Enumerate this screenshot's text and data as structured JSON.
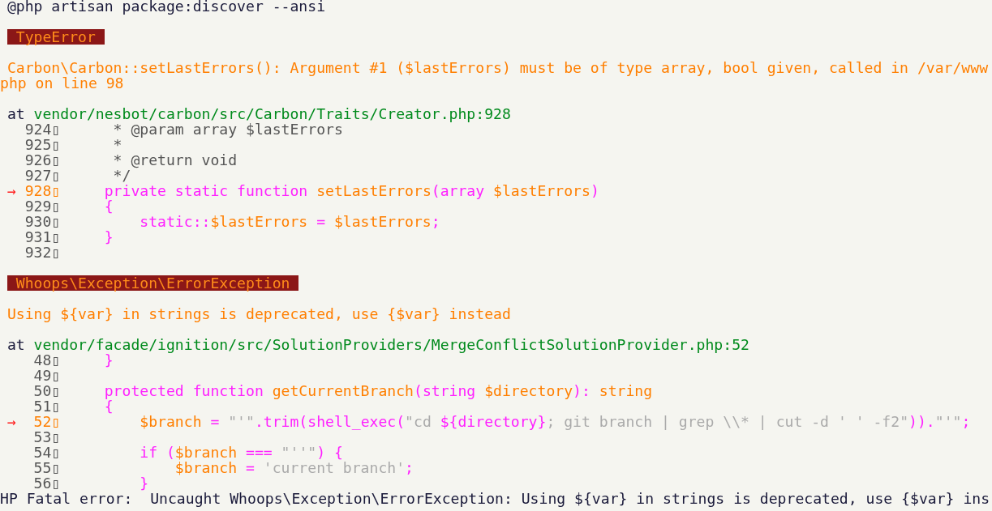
{
  "command": "@php artisan package:discover --ansi",
  "errors": [
    {
      "type": "TypeError",
      "message_lines": [
        "Carbon\\Carbon::setLastErrors(): Argument #1 ($lastErrors) must be of type array, bool given, called in /var/www",
        "php on line 98"
      ],
      "location": {
        "prefix": "at",
        "path": "vendor/nesbot/carbon/src/Carbon/Traits/Creator.php:928"
      },
      "code": [
        {
          "number": "924▯",
          "current": false,
          "segments": [
            {
              "kind": "comment",
              "text": "      * @param array $lastErrors"
            }
          ]
        },
        {
          "number": "925▯",
          "current": false,
          "segments": [
            {
              "kind": "comment",
              "text": "      *"
            }
          ]
        },
        {
          "number": "926▯",
          "current": false,
          "segments": [
            {
              "kind": "comment",
              "text": "      * @return void"
            }
          ]
        },
        {
          "number": "927▯",
          "current": false,
          "segments": [
            {
              "kind": "comment",
              "text": "      */"
            }
          ]
        },
        {
          "number": "928▯",
          "current": true,
          "marker": "→",
          "segments": [
            {
              "kind": "keyword",
              "text": "     private static function "
            },
            {
              "kind": "name",
              "text": "setLastErrors"
            },
            {
              "kind": "keyword",
              "text": "(array "
            },
            {
              "kind": "name",
              "text": "$lastErrors"
            },
            {
              "kind": "keyword",
              "text": ")"
            }
          ]
        },
        {
          "number": "929▯",
          "current": false,
          "segments": [
            {
              "kind": "keyword",
              "text": "     {"
            }
          ]
        },
        {
          "number": "930▯",
          "current": false,
          "segments": [
            {
              "kind": "keyword",
              "text": "         static::"
            },
            {
              "kind": "name",
              "text": "$lastErrors"
            },
            {
              "kind": "keyword",
              "text": " = "
            },
            {
              "kind": "name",
              "text": "$lastErrors"
            },
            {
              "kind": "keyword",
              "text": ";"
            }
          ]
        },
        {
          "number": "931▯",
          "current": false,
          "segments": [
            {
              "kind": "keyword",
              "text": "     }"
            }
          ]
        },
        {
          "number": "932▯",
          "current": false
        }
      ]
    },
    {
      "type": "Whoops\\Exception\\ErrorException",
      "message_lines": [
        "Using ${var} in strings is deprecated, use {$var} instead"
      ],
      "location": {
        "prefix": "at",
        "path": "vendor/facade/ignition/src/SolutionProviders/MergeConflictSolutionProvider.php:52"
      },
      "code": [
        {
          "number": "48▯",
          "current": false,
          "segments": [
            {
              "kind": "keyword",
              "text": "     }"
            }
          ]
        },
        {
          "number": "49▯",
          "current": false
        },
        {
          "number": "50▯",
          "current": false,
          "segments": [
            {
              "kind": "keyword",
              "text": "     protected function "
            },
            {
              "kind": "name",
              "text": "getCurrentBranch"
            },
            {
              "kind": "keyword",
              "text": "(string "
            },
            {
              "kind": "name",
              "text": "$directory"
            },
            {
              "kind": "keyword",
              "text": "): "
            },
            {
              "kind": "name",
              "text": "string"
            }
          ]
        },
        {
          "number": "51▯",
          "current": false,
          "segments": [
            {
              "kind": "keyword",
              "text": "     {"
            }
          ]
        },
        {
          "number": "52▯",
          "current": true,
          "marker": "→",
          "segments": [
            {
              "kind": "name",
              "text": "         $branch"
            },
            {
              "kind": "keyword",
              "text": " = "
            },
            {
              "kind": "string",
              "text": "\"'\""
            },
            {
              "kind": "keyword",
              "text": ".trim(shell_exec("
            },
            {
              "kind": "string",
              "text": "\"cd "
            },
            {
              "kind": "keyword",
              "text": "${directory}"
            },
            {
              "kind": "string",
              "text": "; git branch | grep \\\\* | cut -d ' ' -f2\""
            },
            {
              "kind": "keyword",
              "text": "))."
            },
            {
              "kind": "string",
              "text": "\"'\""
            },
            {
              "kind": "keyword",
              "text": ";"
            }
          ]
        },
        {
          "number": "53▯",
          "current": false
        },
        {
          "number": "54▯",
          "current": false,
          "segments": [
            {
              "kind": "keyword",
              "text": "         if ("
            },
            {
              "kind": "name",
              "text": "$branch"
            },
            {
              "kind": "keyword",
              "text": " === "
            },
            {
              "kind": "string",
              "text": "\"''\""
            },
            {
              "kind": "keyword",
              "text": ") {"
            }
          ]
        },
        {
          "number": "55▯",
          "current": false,
          "segments": [
            {
              "kind": "name",
              "text": "             $branch"
            },
            {
              "kind": "keyword",
              "text": " = "
            },
            {
              "kind": "string",
              "text": "'current branch'"
            },
            {
              "kind": "keyword",
              "text": ";"
            }
          ]
        },
        {
          "number": "56▯",
          "current": false,
          "segments": [
            {
              "kind": "keyword",
              "text": "         }"
            }
          ]
        }
      ]
    }
  ],
  "fatal_line": "HP Fatal error:  Uncaught Whoops\\Exception\\ErrorException: Using ${var} in strings is deprecated, use {$var} ins"
}
